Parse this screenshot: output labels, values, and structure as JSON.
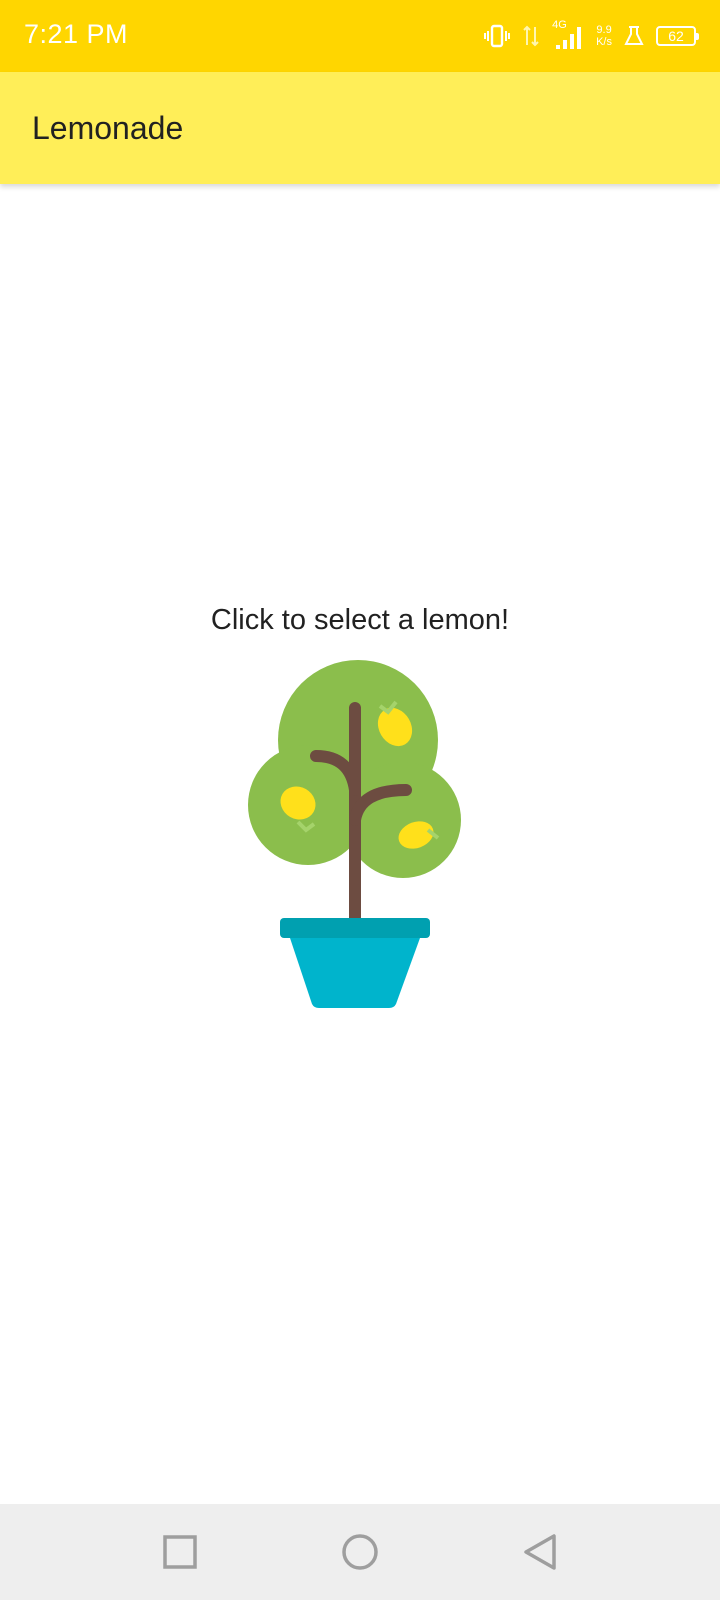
{
  "status_bar": {
    "time": "7:21 PM",
    "network_type": "4G",
    "net_speed_value": "9.9",
    "net_speed_unit": "K/s",
    "battery_level": "62",
    "icons": [
      "vibrate-icon",
      "data-transfer-icon",
      "signal-icon",
      "lab-flask-icon",
      "battery-icon"
    ]
  },
  "app_bar": {
    "title": "Lemonade",
    "background_color": "#FFEE58"
  },
  "main": {
    "instruction": "Click to select a lemon!",
    "image_icon": "lemon-tree-icon"
  },
  "nav_bar": {
    "icons": [
      "recents-icon",
      "home-icon",
      "back-icon"
    ]
  },
  "colors": {
    "status_bar": "#FFD600",
    "app_bar": "#FFEE58",
    "tree_foliage": "#8BBE4C",
    "tree_trunk": "#6D4C41",
    "lemon": "#FFE01B",
    "pot": "#00B4CC",
    "pot_rim": "#00A0B0"
  }
}
